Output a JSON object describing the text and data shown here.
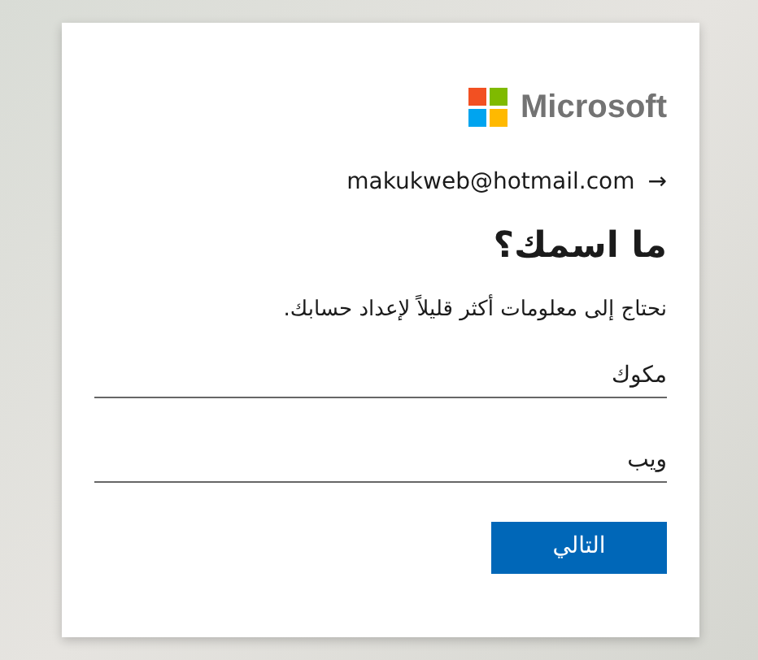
{
  "brand": {
    "name": "Microsoft"
  },
  "identity": {
    "email": "makukweb@hotmail.com",
    "back_arrow": "→"
  },
  "title": "ما اسمك؟",
  "description": "نحتاج إلى معلومات أكثر قليلاً لإعداد حسابك.",
  "fields": [
    {
      "value": "مكوك"
    },
    {
      "value": "ويب"
    }
  ],
  "buttons": [
    {
      "label": "التالي",
      "kind": "primary"
    }
  ]
}
